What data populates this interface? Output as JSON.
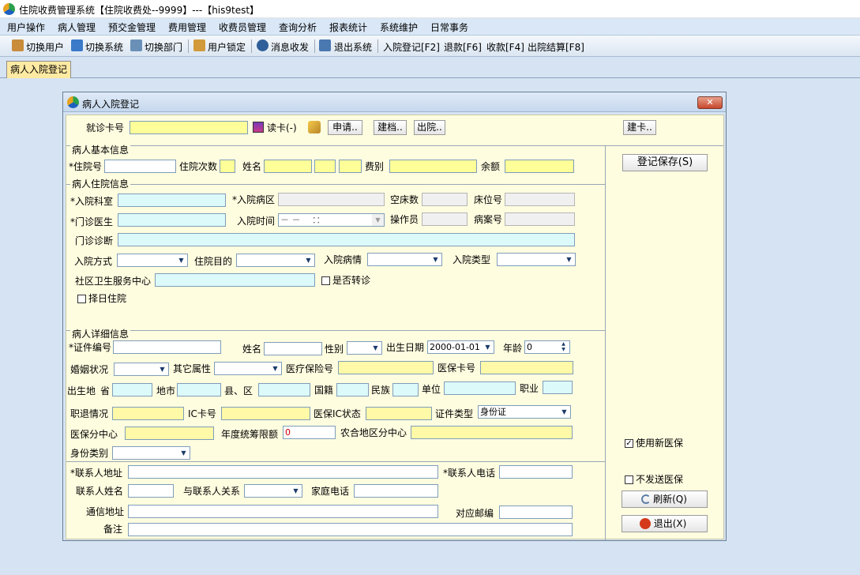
{
  "window": {
    "title": "住院收费管理系统【住院收费处--9999】---【his9test】"
  },
  "menu": [
    "用户操作",
    "病人管理",
    "预交金管理",
    "费用管理",
    "收费员管理",
    "查询分析",
    "报表统计",
    "系统维护",
    "日常事务"
  ],
  "toolbar": [
    "切换用户",
    "切换系统",
    "切换部门",
    "用户锁定",
    "消息收发",
    "退出系统",
    "入院登记[F2]",
    "退款[F6]",
    "收款[F4]",
    "出院结算[F8]"
  ],
  "tab": {
    "label": "病人入院登记"
  },
  "dialog": {
    "title": "病人入院登记",
    "card_label": "就诊卡号",
    "read_card": "读卡(-)",
    "apply": "申请..",
    "build": "建档..",
    "discharge": "出院..",
    "make_card": "建卡..",
    "basic": {
      "section": "病人基本信息",
      "admission_no": "*住院号",
      "visit_count": "住院次数",
      "name": "姓名",
      "fee_type": "费别",
      "balance": "余额"
    },
    "hospital": {
      "section": "病人住院信息",
      "dept": "*入院科室",
      "ward": "*入院病区",
      "empty_beds": "空床数",
      "bed_no": "床位号",
      "doctor": "*门诊医生",
      "admit_time": "入院时间",
      "admit_time_value": "－ －　 ：：",
      "operator": "操作员",
      "record_no": "病案号",
      "diagnosis": "门诊诊断",
      "admit_mode": "入院方式",
      "purpose": "住院目的",
      "condition": "入院病情",
      "admit_type": "入院类型",
      "community": "社区卫生服务中心",
      "transfer": "是否转诊",
      "choose_day": "择日住院"
    },
    "detail": {
      "section": "病人详细信息",
      "id_no": "*证件编号",
      "name": "姓名",
      "sex": "性别",
      "birth": "出生日期",
      "birth_value": "2000-01-01",
      "age": "年龄",
      "age_value": "0",
      "marital": "婚姻状况",
      "other_attr": "其它属性",
      "insurance_no": "医疗保险号",
      "insurance_card": "医保卡号",
      "birthplace": "出生地",
      "province": "省",
      "city": "地市",
      "county": "县、区",
      "nationality": "国籍",
      "ethnicity": "民族",
      "employer": "单位",
      "occupation": "职业",
      "retire": "职退情况",
      "ic_card": "IC卡号",
      "ic_status": "医保IC状态",
      "id_type": "证件类型",
      "id_type_value": "身份证",
      "center": "医保分中心",
      "annual_limit": "年度统筹限额",
      "annual_limit_value": "0",
      "rural_center": "农合地区分中心",
      "identity": "身份类别"
    },
    "contact": {
      "address": "*联系人地址",
      "phone": "*联系人电话",
      "name": "联系人姓名",
      "relation": "与联系人关系",
      "home_phone": "家庭电话",
      "mail_addr": "通信地址",
      "zip": "对应邮编",
      "remark": "备注"
    },
    "side": {
      "save": "登记保存(S)",
      "new_insurance": "使用新医保",
      "no_send": "不发送医保",
      "refresh": "刷新(Q)",
      "exit": "退出(X)"
    }
  },
  "colors": {
    "required_yellow": "#ffff99",
    "info_cyan": "#dcfafa",
    "panel_bg": "#fffde0"
  }
}
